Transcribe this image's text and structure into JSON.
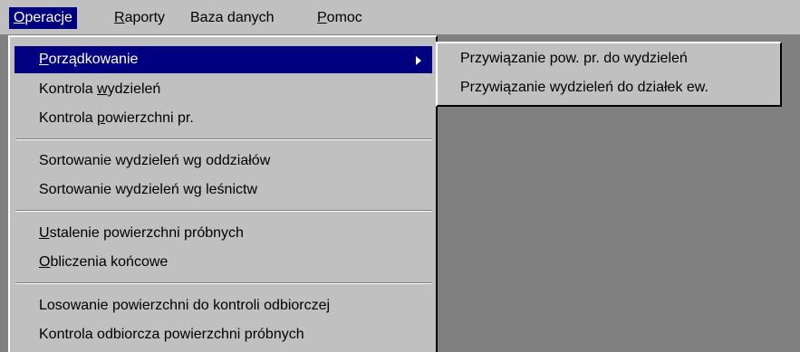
{
  "menubar": {
    "items": [
      {
        "pre": "",
        "u": "O",
        "post": "peracje"
      },
      {
        "pre": "",
        "u": "R",
        "post": "aporty"
      },
      {
        "pre": "Baza danych",
        "u": "",
        "post": ""
      },
      {
        "pre": "",
        "u": "P",
        "post": "omoc"
      }
    ]
  },
  "dropdown": {
    "items": [
      {
        "pre": "",
        "u": "P",
        "post": "orządkowanie"
      },
      {
        "pre": "Kontrola ",
        "u": "w",
        "post": "ydzieleń"
      },
      {
        "pre": "Kontrola ",
        "u": "p",
        "post": "owierzchni pr."
      },
      {
        "pre": "Sortowanie wydzieleń wg oddziałów",
        "u": "",
        "post": ""
      },
      {
        "pre": "Sortowanie wydzieleń wg leśnictw",
        "u": "",
        "post": ""
      },
      {
        "pre": "",
        "u": "U",
        "post": "stalenie powierzchni próbnych"
      },
      {
        "pre": "",
        "u": "O",
        "post": "bliczenia końcowe"
      },
      {
        "pre": "Losowanie powierzchni do kontroli odbiorczej",
        "u": "",
        "post": ""
      },
      {
        "pre": "Kontrola odbiorcza powierzchni próbnych",
        "u": "",
        "post": ""
      }
    ]
  },
  "submenu": {
    "items": [
      "Przywiązanie pow. pr. do wydzieleń",
      "Przywiązanie wydzieleń do działek ew."
    ]
  },
  "colors": {
    "menu_face": "#c0c0c0",
    "highlight": "#000080",
    "desktop": "#808080"
  }
}
